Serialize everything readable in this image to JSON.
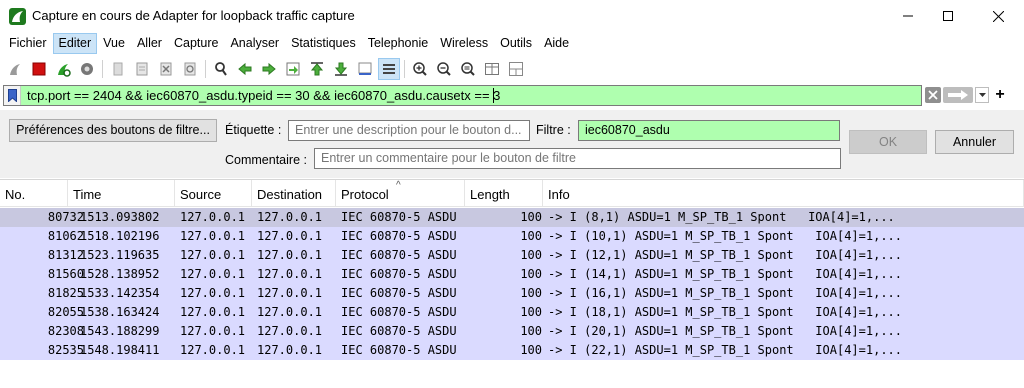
{
  "window": {
    "title": "Capture en cours de Adapter for loopback traffic capture",
    "app_icon": "wireshark-shark-fin-icon",
    "controls": [
      "minimize-icon",
      "maximize-icon",
      "close-icon"
    ]
  },
  "menu": [
    "Fichier",
    "Editer",
    "Vue",
    "Aller",
    "Capture",
    "Analyser",
    "Statistiques",
    "Telephonie",
    "Wireless",
    "Outils",
    "Aide"
  ],
  "menu_active_index": 1,
  "toolbar": {
    "icons": [
      "start-capture-icon",
      "stop-capture-icon",
      "restart-capture-icon",
      "capture-options-icon",
      "open-file-icon",
      "save-file-icon",
      "close-file-icon",
      "reload-file-icon",
      "find-packet-icon",
      "go-back-icon",
      "go-forward-icon",
      "go-to-packet-icon",
      "go-first-icon",
      "go-last-icon",
      "auto-scroll-icon",
      "colorize-icon",
      "zoom-in-icon",
      "zoom-out-icon",
      "normal-size-icon",
      "resize-columns-icon"
    ]
  },
  "filter": {
    "value": "tcp.port == 2404 && iec60870_asdu.typeid == 30 && iec60870_asdu.causetx == 3",
    "bg_color": "#afffaf"
  },
  "filter_button_prefs": {
    "prefs_button": "Préférences des boutons de filtre...",
    "label_caption": "Étiquette :",
    "label_placeholder": "Entrer une description pour le bouton d...",
    "filter_caption": "Filtre :",
    "filter_value": "iec60870_asdu",
    "comment_caption": "Commentaire :",
    "comment_placeholder": "Entrer un commentaire pour le bouton de filtre",
    "ok_label": "OK",
    "cancel_label": "Annuler"
  },
  "packet_list": {
    "columns": [
      "No.",
      "Time",
      "Source",
      "Destination",
      "Protocol",
      "Length",
      "Info"
    ],
    "row_color": "#dadaff",
    "rows": [
      {
        "no": "80732",
        "time": "1513.093802",
        "src": "127.0.0.1",
        "dst": "127.0.0.1",
        "proto": "IEC 60870-5 ASDU",
        "len": "100",
        "info": "-> I (8,1) ASDU=1 M_SP_TB_1 Spont   IOA[4]=1,..."
      },
      {
        "no": "81062",
        "time": "1518.102196",
        "src": "127.0.0.1",
        "dst": "127.0.0.1",
        "proto": "IEC 60870-5 ASDU",
        "len": "100",
        "info": "-> I (10,1) ASDU=1 M_SP_TB_1 Spont   IOA[4]=1,..."
      },
      {
        "no": "81312",
        "time": "1523.119635",
        "src": "127.0.0.1",
        "dst": "127.0.0.1",
        "proto": "IEC 60870-5 ASDU",
        "len": "100",
        "info": "-> I (12,1) ASDU=1 M_SP_TB_1 Spont   IOA[4]=1,..."
      },
      {
        "no": "81560",
        "time": "1528.138952",
        "src": "127.0.0.1",
        "dst": "127.0.0.1",
        "proto": "IEC 60870-5 ASDU",
        "len": "100",
        "info": "-> I (14,1) ASDU=1 M_SP_TB_1 Spont   IOA[4]=1,..."
      },
      {
        "no": "81825",
        "time": "1533.142354",
        "src": "127.0.0.1",
        "dst": "127.0.0.1",
        "proto": "IEC 60870-5 ASDU",
        "len": "100",
        "info": "-> I (16,1) ASDU=1 M_SP_TB_1 Spont   IOA[4]=1,..."
      },
      {
        "no": "82055",
        "time": "1538.163424",
        "src": "127.0.0.1",
        "dst": "127.0.0.1",
        "proto": "IEC 60870-5 ASDU",
        "len": "100",
        "info": "-> I (18,1) ASDU=1 M_SP_TB_1 Spont   IOA[4]=1,..."
      },
      {
        "no": "82308",
        "time": "1543.188299",
        "src": "127.0.0.1",
        "dst": "127.0.0.1",
        "proto": "IEC 60870-5 ASDU",
        "len": "100",
        "info": "-> I (20,1) ASDU=1 M_SP_TB_1 Spont   IOA[4]=1,..."
      },
      {
        "no": "82535",
        "time": "1548.198411",
        "src": "127.0.0.1",
        "dst": "127.0.0.1",
        "proto": "IEC 60870-5 ASDU",
        "len": "100",
        "info": "-> I (22,1) ASDU=1 M_SP_TB_1 Spont   IOA[4]=1,..."
      }
    ]
  }
}
